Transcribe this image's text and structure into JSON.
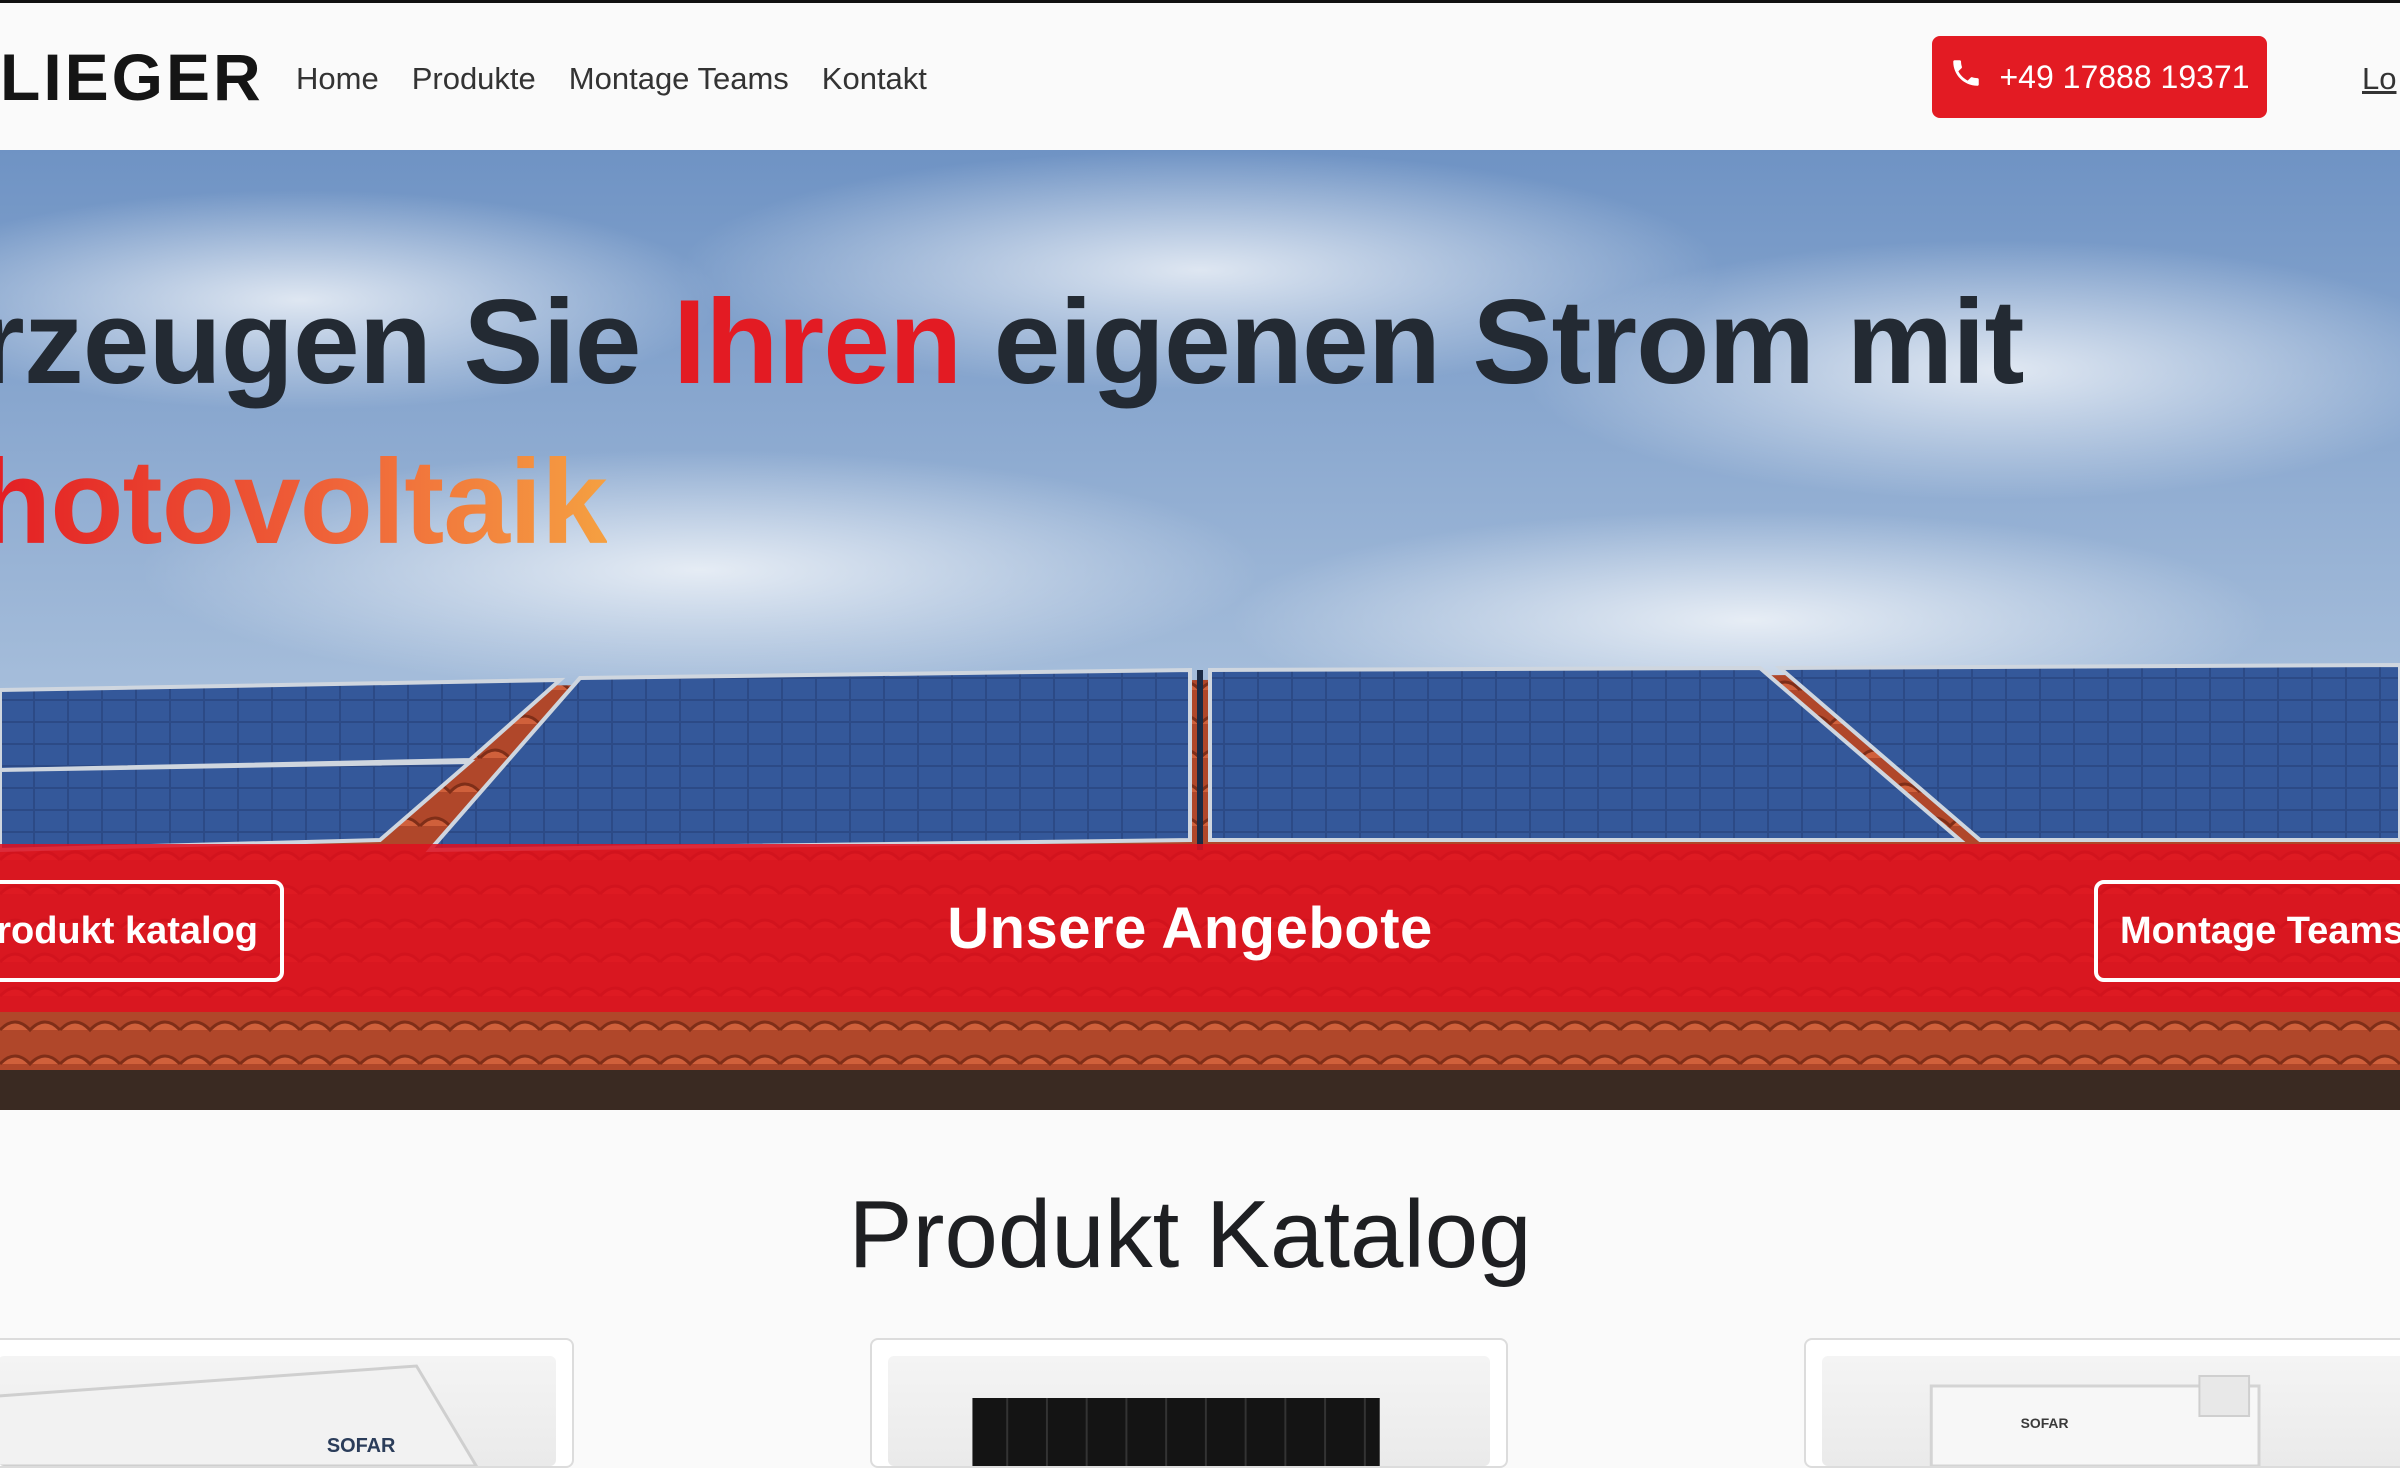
{
  "header": {
    "brand": "LIEGER",
    "nav": [
      "Home",
      "Produkte",
      "Montage Teams",
      "Kontakt"
    ],
    "phone": "+49 17888 19371",
    "login": "Lo"
  },
  "hero": {
    "title_part1": "rzeugen Sie ",
    "title_accent": "Ihren",
    "title_part2": " eigenen Strom mit",
    "title_line2": "hotovoltaik",
    "offers_button": "Unsere Angebote",
    "left_button": "rodukt katalog",
    "right_button": "Montage Teams"
  },
  "catalog": {
    "title": "Produkt Katalog",
    "card_brand": "SOFAR"
  },
  "colors": {
    "accent": "#e31b23",
    "band": "#df0f1e",
    "text_dark": "#232a33"
  },
  "icons": [
    "phone-icon"
  ]
}
